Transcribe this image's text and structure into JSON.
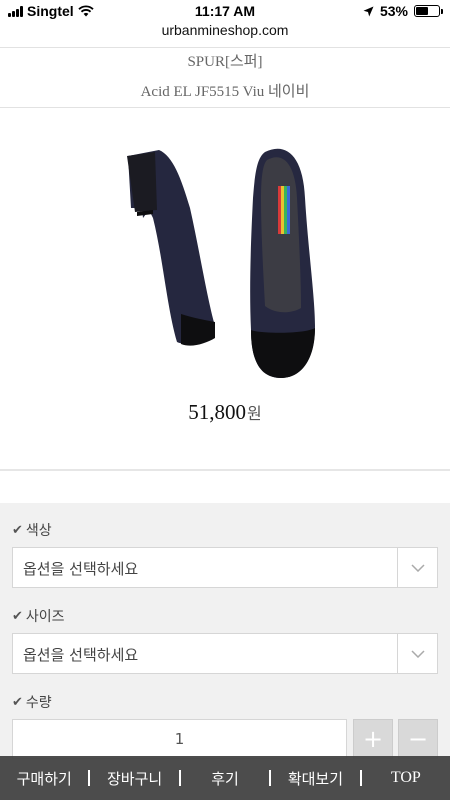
{
  "status_bar": {
    "carrier": "Singtel",
    "time": "11:17 AM",
    "battery_text": "53%",
    "battery_level": 0.53,
    "icons": [
      "signal-icon",
      "wifi-icon",
      "location-icon",
      "battery-icon"
    ]
  },
  "browser": {
    "url": "urbanmineshop.com"
  },
  "product": {
    "brand": "SPUR[스퍼]",
    "name": "Acid EL JF5515 Viu 네이비",
    "price": "51,800",
    "price_unit": "원"
  },
  "options": {
    "color_label": "색상",
    "color_placeholder": "옵션을 선택하세요",
    "size_label": "사이즈",
    "size_placeholder": "옵션을 선택하세요",
    "quantity_label": "수량",
    "quantity_value": "1",
    "plus_label": "+",
    "minus_label": "−"
  },
  "bottom_nav": {
    "buy": "구매하기",
    "cart": "장바구니",
    "reviews": "후기",
    "zoom": "확대보기",
    "top": "TOP"
  },
  "colors": {
    "panel_bg": "#f1f1f1",
    "nav_bg": "#404040",
    "shoe_body": "#2a2c48",
    "shoe_toe": "#101010"
  }
}
